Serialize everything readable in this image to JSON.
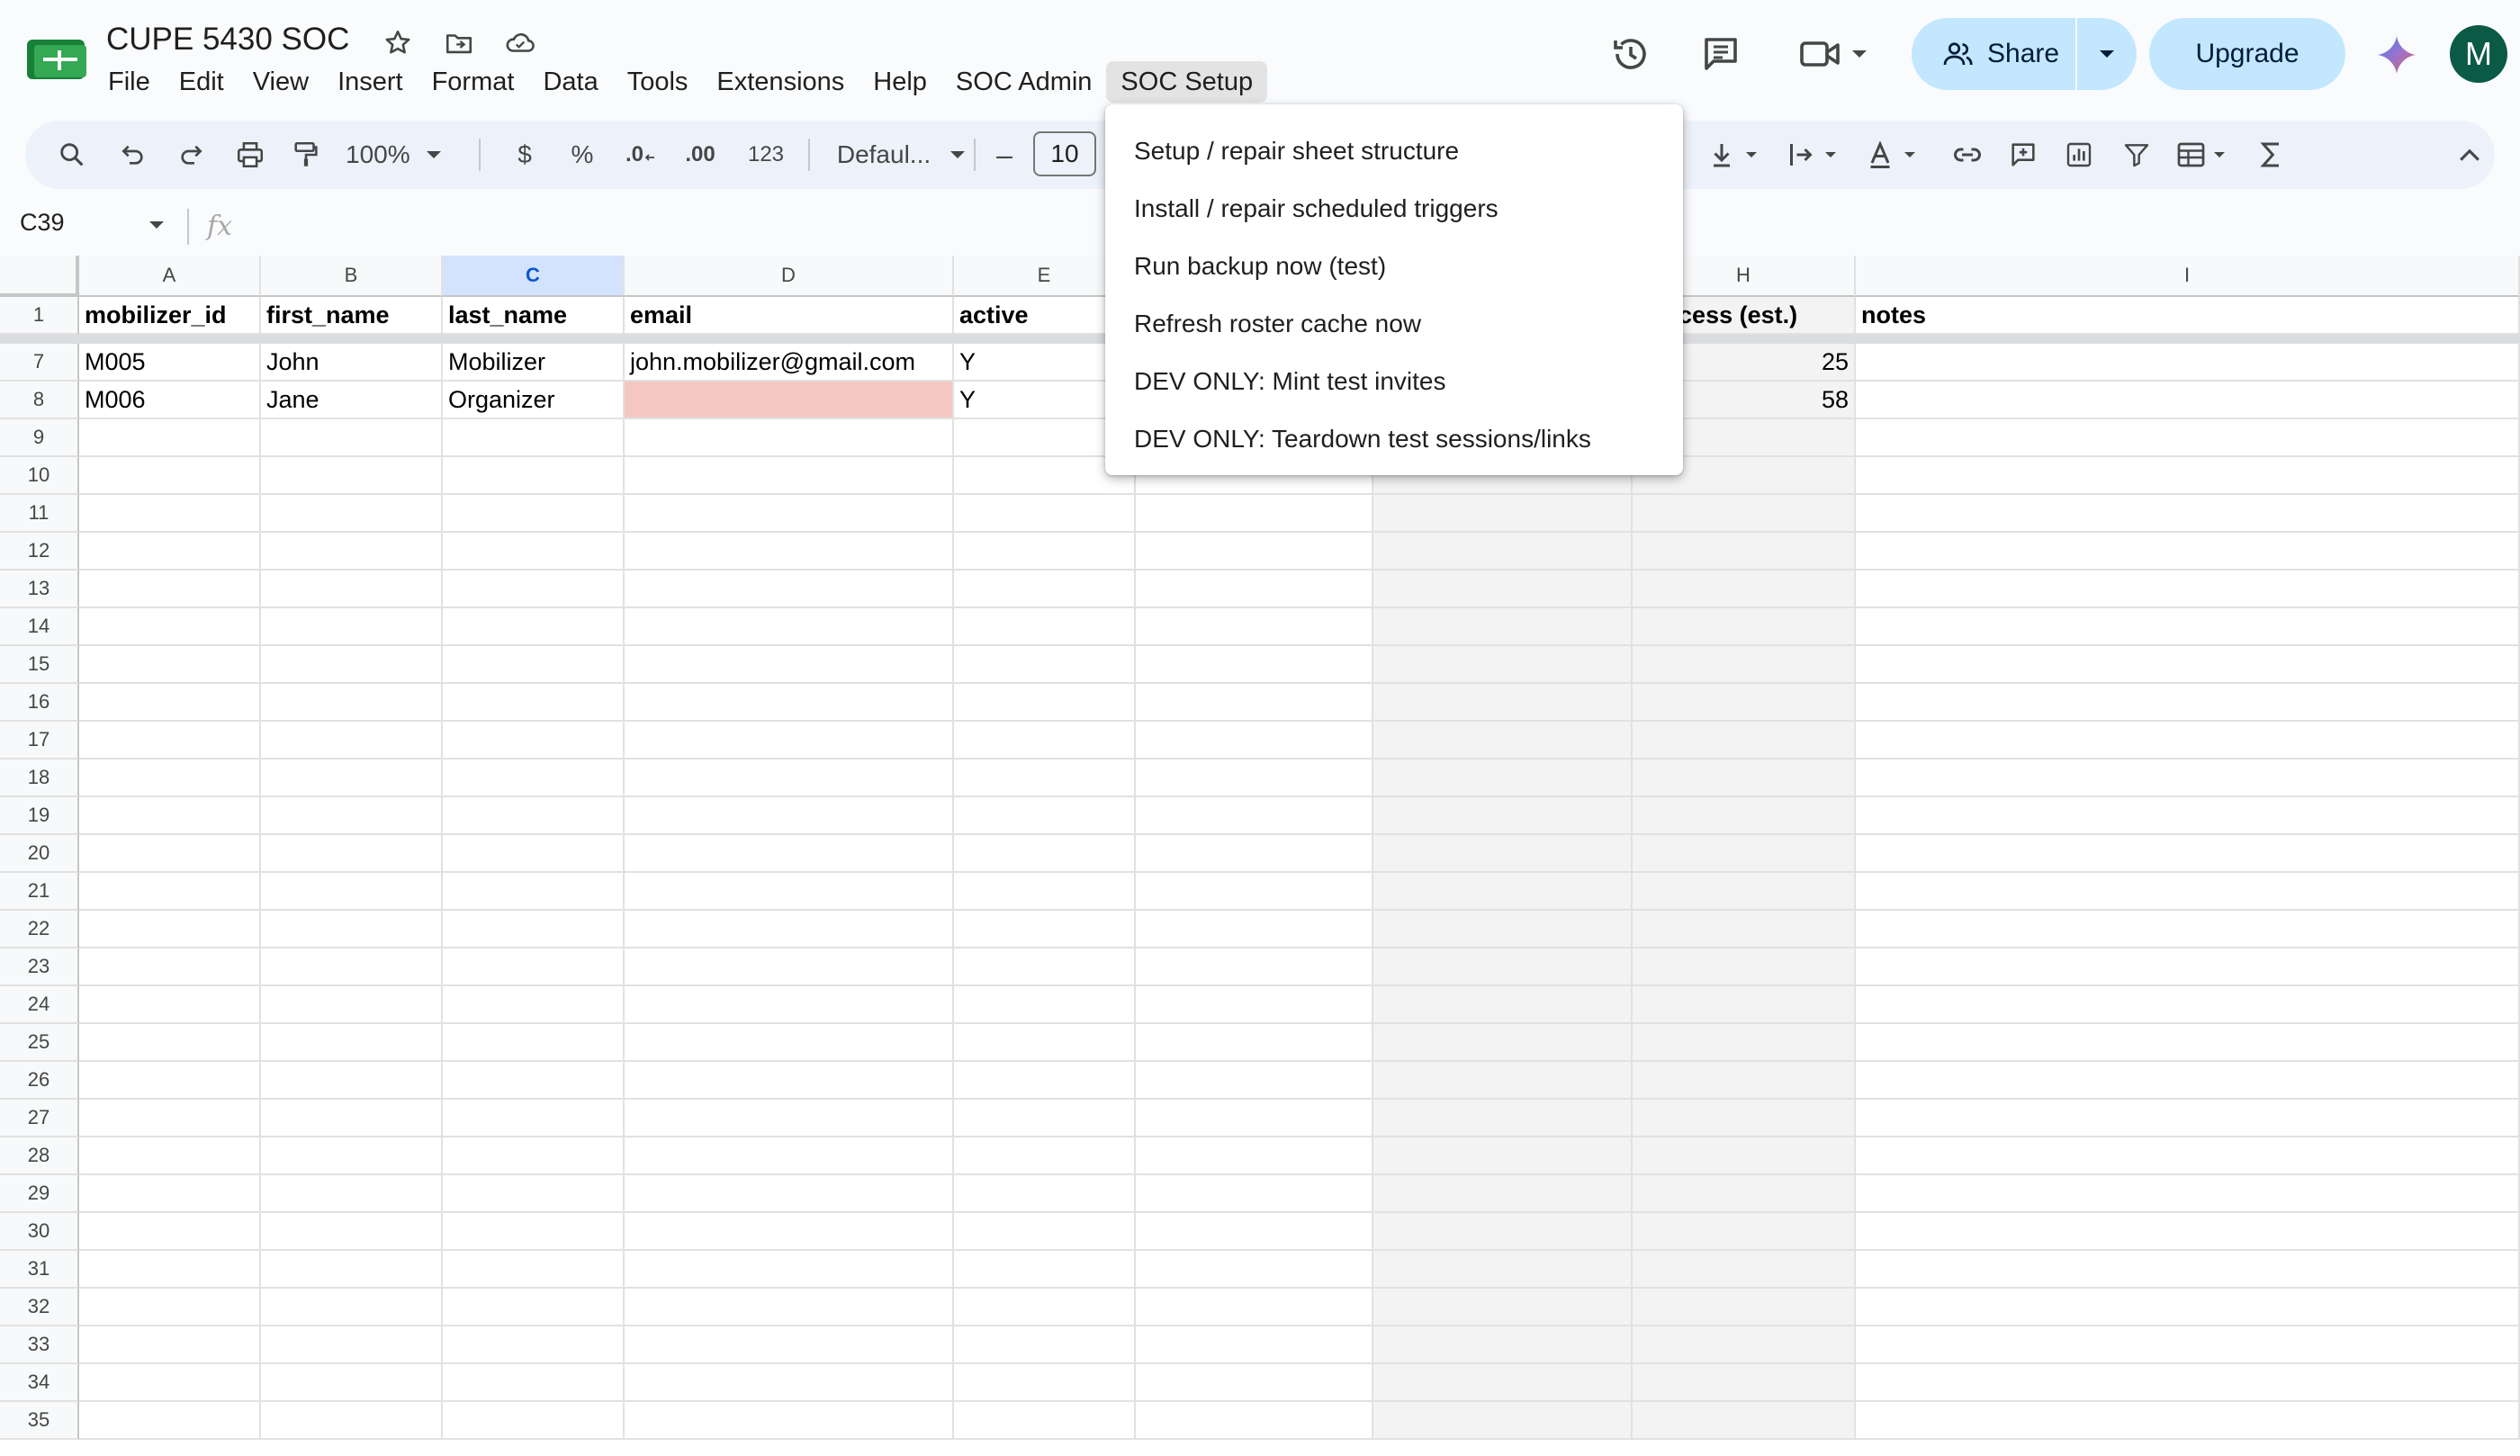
{
  "document": {
    "title": "CUPE 5430 SOC"
  },
  "menubar": [
    "File",
    "Edit",
    "View",
    "Insert",
    "Format",
    "Data",
    "Tools",
    "Extensions",
    "Help",
    "SOC Admin",
    "SOC Setup"
  ],
  "header_actions": {
    "share_label": "Share",
    "upgrade_label": "Upgrade",
    "avatar_initial": "M"
  },
  "toolbar": {
    "zoom": "100%",
    "currency": "$",
    "percent": "%",
    "decrease_decimal": ".0",
    "increase_decimal": ".00",
    "number_format": "123",
    "font": "Defaul...",
    "font_size": "10",
    "minus": "–"
  },
  "formula_bar": {
    "cell_ref": "C39",
    "fx": "fx"
  },
  "columns": [
    "A",
    "B",
    "C",
    "D",
    "E",
    "H",
    "I"
  ],
  "header_row": {
    "num": "1",
    "cells": [
      "mobilizer_id",
      "first_name",
      "last_name",
      "email",
      "active",
      "l access (est.)",
      "notes"
    ]
  },
  "data_rows": [
    {
      "num": "7",
      "cells": [
        "M005",
        "John",
        "Mobilizer",
        "john.mobilizer@gmail.com",
        "Y",
        "25",
        ""
      ]
    },
    {
      "num": "8",
      "cells": [
        "M006",
        "Jane",
        "Organizer",
        "",
        "Y",
        "58",
        ""
      ]
    }
  ],
  "empty_rows": [
    "9",
    "10",
    "11",
    "12",
    "13",
    "14",
    "15",
    "16",
    "17",
    "18",
    "19",
    "20",
    "21",
    "22",
    "23",
    "24",
    "25",
    "26",
    "27",
    "28",
    "29",
    "30",
    "31",
    "32",
    "33",
    "34",
    "35"
  ],
  "soc_setup_menu": [
    "Setup / repair sheet structure",
    "Install / repair scheduled triggers",
    "Run backup now (test)",
    "Refresh roster cache now",
    "DEV ONLY: Mint test invites",
    "DEV ONLY: Teardown test sessions/links"
  ],
  "colors": {
    "accent": "#c2e7ff",
    "selected_col": "#d3e3fd",
    "error_cell": "#f4c7c3",
    "avatar": "#0b5a45"
  }
}
